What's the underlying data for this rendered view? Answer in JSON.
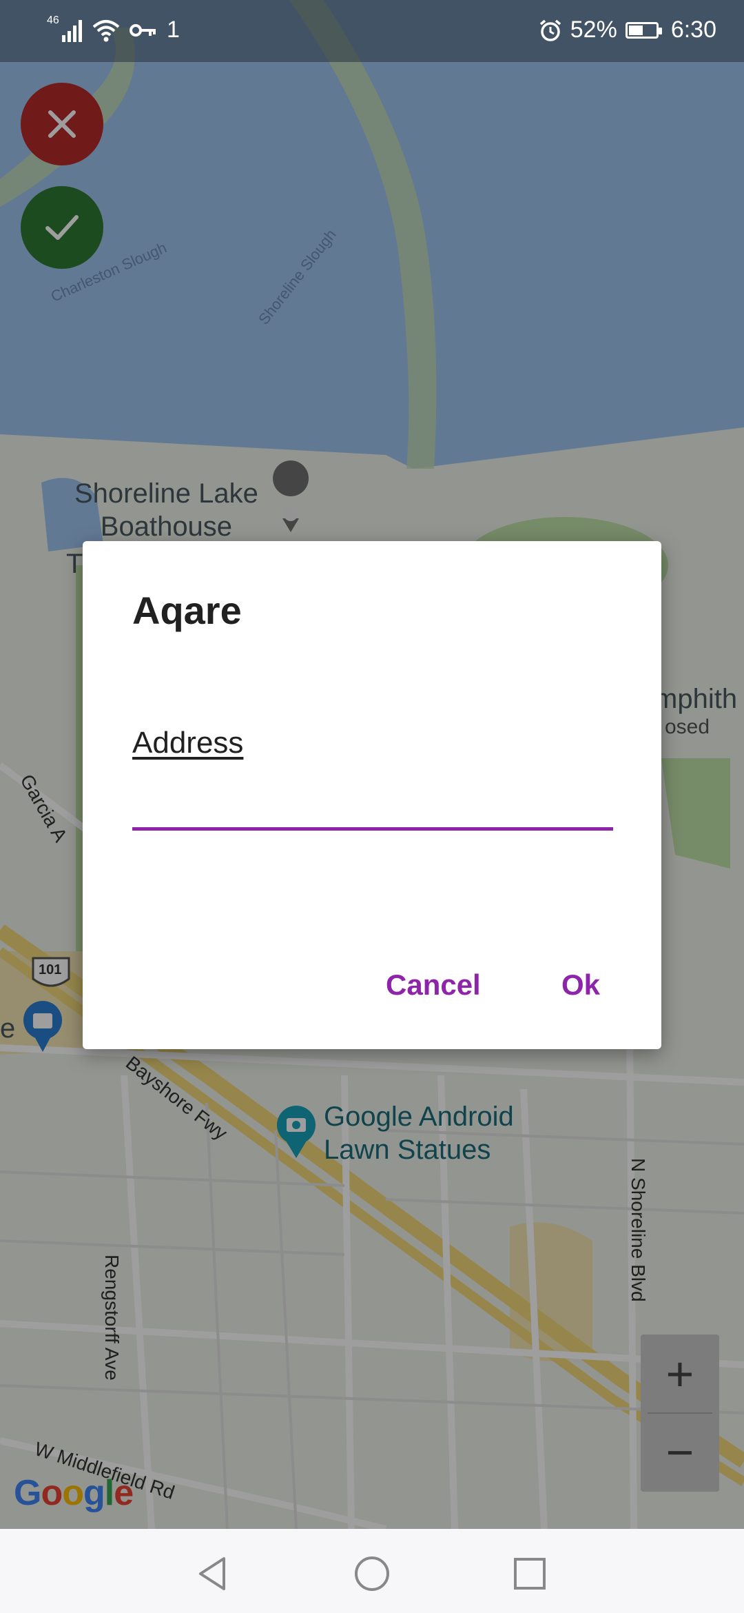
{
  "status_bar": {
    "network": "46",
    "sim_indicator": "1",
    "battery_percent": "52%",
    "battery_level": 0.52,
    "time": "6:30"
  },
  "map": {
    "labels": {
      "boathouse": "Shoreline Lake\nBoathouse",
      "statues": "Google Android\nLawn Statues",
      "amphitheatre_partial": "mphith",
      "closed_partial": "osed",
      "charleston_slough": "Charleston Slough",
      "shoreline_slough": "Shoreline Slough",
      "garcia_ave": "Garcia A",
      "bayshore_fwy": "Bayshore Fwy",
      "rengstorff_ave": "Rengstorff Ave",
      "n_shoreline_blvd": "N Shoreline Blvd",
      "w_middlefield_rd": "W Middlefield Rd",
      "hwy_101": "101",
      "left_edge_t": "T",
      "left_edge_e": "e"
    },
    "zoom_in": "+",
    "zoom_out": "−",
    "logo": {
      "G": "G",
      "o1": "o",
      "o2": "o",
      "g": "g",
      "l": "l",
      "e": "e"
    }
  },
  "icons": {
    "close": "close-icon",
    "check": "check-icon",
    "back": "back-triangle-icon",
    "home": "home-circle-icon",
    "recents": "recents-square-icon"
  },
  "dialog": {
    "title": "Aqare",
    "address_label": "Address",
    "address_value": "",
    "cancel_label": "Cancel",
    "ok_label": "Ok"
  },
  "colors": {
    "accent": "#8e24aa",
    "close_fab": "#b52a2a",
    "check_fab": "#2e7a35"
  }
}
